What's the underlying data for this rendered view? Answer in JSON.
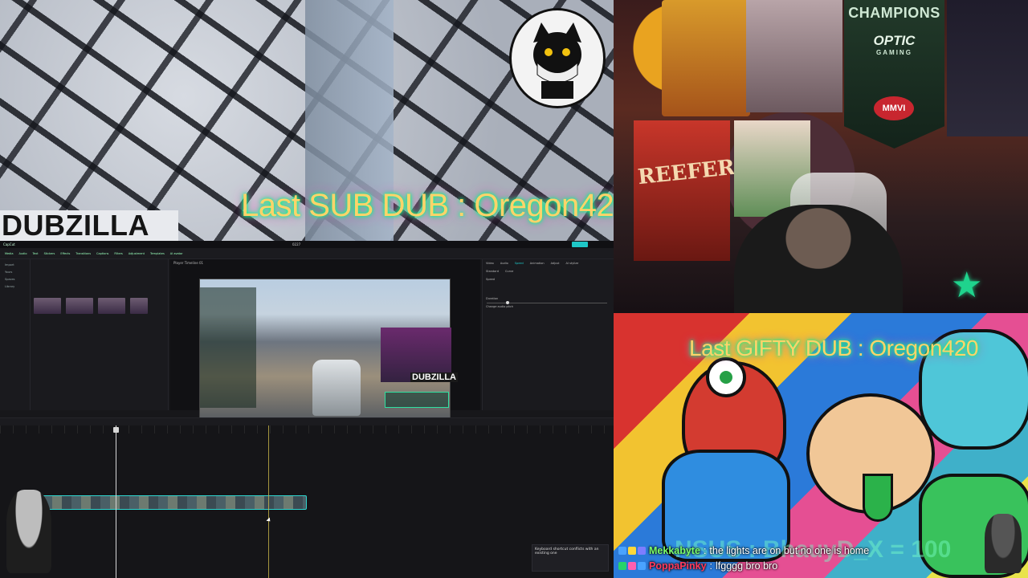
{
  "overlays": {
    "brand": "DUBZILLA",
    "last_sub": "Last SUB DUB : Oregon420",
    "last_gifty": "Last GIFTY DUB : Oregon420",
    "ticker_ghost": "NSUS : BhauyD_X = 100"
  },
  "webcam": {
    "banner_champions": "CHAMPIONS",
    "banner_optic": "OPTIC",
    "banner_gaming": "GAMING",
    "banner_mmvi": "MMVI",
    "poster_text": "REEFER"
  },
  "editor": {
    "app_name": "CapCut",
    "window_title": "0227",
    "toolbar_items": [
      "Media",
      "Audio",
      "Text",
      "Stickers",
      "Effects",
      "Transitions",
      "Captions",
      "Filters",
      "Adjustment",
      "Templates",
      "AI avatar"
    ],
    "media_sidebar": [
      "Import",
      "Yours",
      "Spaces",
      "Library"
    ],
    "player_header": "Player Timeline 01",
    "stream_overlay_name": "DUBZILLA",
    "props_tabs": [
      "Video",
      "Audio",
      "Speed",
      "Animation",
      "Adjust",
      "AI stylize"
    ],
    "props_subtabs": [
      "Standard",
      "Curve"
    ],
    "speed_label": "Speed",
    "duration_label": "Duration",
    "change_pitch_label": "Change audio pitch",
    "shortcut_toast": "Keyboard shortcut conflicts with an existing one"
  },
  "chat": [
    {
      "user": "Mekkabyte",
      "user_color": "#7cff6b",
      "message": "the lights are on but no one is home"
    },
    {
      "user": "PoppaPinky",
      "user_color": "#ff3a5c",
      "message": "lfgggg bro bro"
    }
  ],
  "colors": {
    "accent_teal": "#1fc7c7",
    "neon_text": "#ffd36a",
    "neon_glow": "#00ff88"
  }
}
